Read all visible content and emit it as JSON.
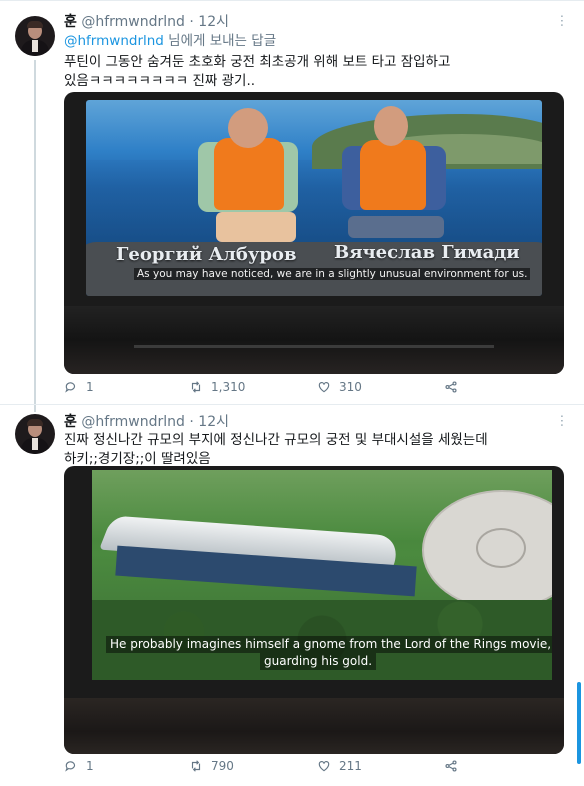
{
  "tweets": [
    {
      "name": "훈",
      "handle": "@hfrmwndrlnd",
      "dot": "·",
      "time": "12시",
      "reply_handle": "@hfrmwndrlnd",
      "reply_suffix": " 님에게 보내는 답글",
      "text": "푸틴이 그동안 숨겨둔 초호화 궁전 최초공개 위해 보트 타고 잠입하고\n있음ㅋㅋㅋㅋㅋㅋㅋㅋ 진짜 광기..",
      "video": {
        "name_left": "Георгий Албуров",
        "name_right": "Вячеслав Гимади",
        "subtitle": "As you may have noticed, we are in a slightly unusual environment for us."
      },
      "replies": "1",
      "retweets": "1,310",
      "likes": "310"
    },
    {
      "name": "훈",
      "handle": "@hfrmwndrlnd",
      "dot": "·",
      "time": "12시",
      "text": "진짜 정신나간 규모의 부지에 정신나간 규모의 궁전 및 부대시설을 세웠는데\n하키;;경기장;;이 딸려있음",
      "video": {
        "subtitle_line1": "He probably imagines himself a gnome from the Lord of the Rings movie,",
        "subtitle_line2": "guarding his gold."
      },
      "replies": "1",
      "retweets": "790",
      "likes": "211"
    }
  ],
  "colors": {
    "link": "#1b95e0",
    "muted": "#657786",
    "text": "#14171a"
  }
}
